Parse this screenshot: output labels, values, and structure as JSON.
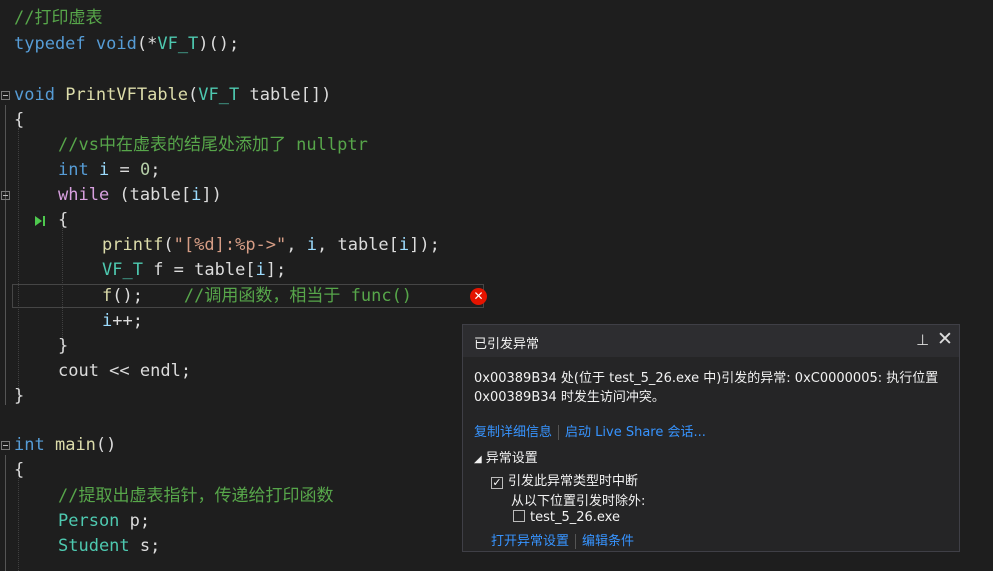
{
  "code": {
    "l1_comment": "//打印虚表",
    "l2_typedef": "typedef",
    "l2_void": "void",
    "l2_rest_a": "(*",
    "l2_type": "VF_T",
    "l2_rest_b": ")();",
    "l4_void": "void",
    "l4_fn": "PrintVFTable",
    "l4_p1": "(",
    "l4_type": "VF_T",
    "l4_p2": " table[])",
    "l5_brace": "{",
    "l6_comment": "//vs中在虚表的结尾处添加了 nullptr",
    "l7_int": "int",
    "l7_var": "i",
    "l7_eq": " = ",
    "l7_num": "0",
    "l7_semi": ";",
    "l8_while": "while",
    "l8_rest_a": " (table[",
    "l8_var": "i",
    "l8_rest_b": "])",
    "l9_brace": "{",
    "l10_fn": "printf",
    "l10_p": "(",
    "l10_str": "\"[%d]:%p->\"",
    "l10_rest_a": ", ",
    "l10_var1": "i",
    "l10_rest_b": ", table[",
    "l10_var2": "i",
    "l10_rest_c": "]);",
    "l11_type": "VF_T",
    "l11_rest_a": " f = table[",
    "l11_var": "i",
    "l11_rest_b": "];",
    "l12_fn": "f",
    "l12_rest": "();",
    "l12_comment": "//调用函数，相当于 func()",
    "l13_var": "i",
    "l13_rest": "++;",
    "l14_brace": "}",
    "l15_a": "cout << endl;",
    "l16_brace": "}",
    "l18_int": "int",
    "l18_fn": "main",
    "l18_rest": "()",
    "l19_brace": "{",
    "l20_comment": "//提取出虚表指针，传递给打印函数",
    "l21_type": "Person",
    "l21_rest": " p;",
    "l22_type": "Student",
    "l22_rest": " s;"
  },
  "icons": {
    "error": "✕",
    "pin": "⊥",
    "close": "✕",
    "triangle": "◢",
    "check": "✓"
  },
  "popup": {
    "title": "已引发异常",
    "message": "0x00389B34 处(位于 test_5_26.exe 中)引发的异常: 0xC0000005: 执行位置 0x00389B34 时发生访问冲突。",
    "copy_details": "复制详细信息",
    "live_share": "启动 Live Share 会话...",
    "section_title": "异常设置",
    "break_when_thrown": "引发此异常类型时中断",
    "except_from": "从以下位置引发时除外:",
    "module": "test_5_26.exe",
    "open_settings": "打开异常设置",
    "edit_conditions": "编辑条件"
  },
  "colors": {
    "background": "#1e1e1e",
    "comment": "#57a64a",
    "keyword": "#569cd6",
    "type": "#4ec9b0",
    "function": "#dcdcaa",
    "string": "#d69d85",
    "link": "#3794ff",
    "error": "#e51400"
  }
}
